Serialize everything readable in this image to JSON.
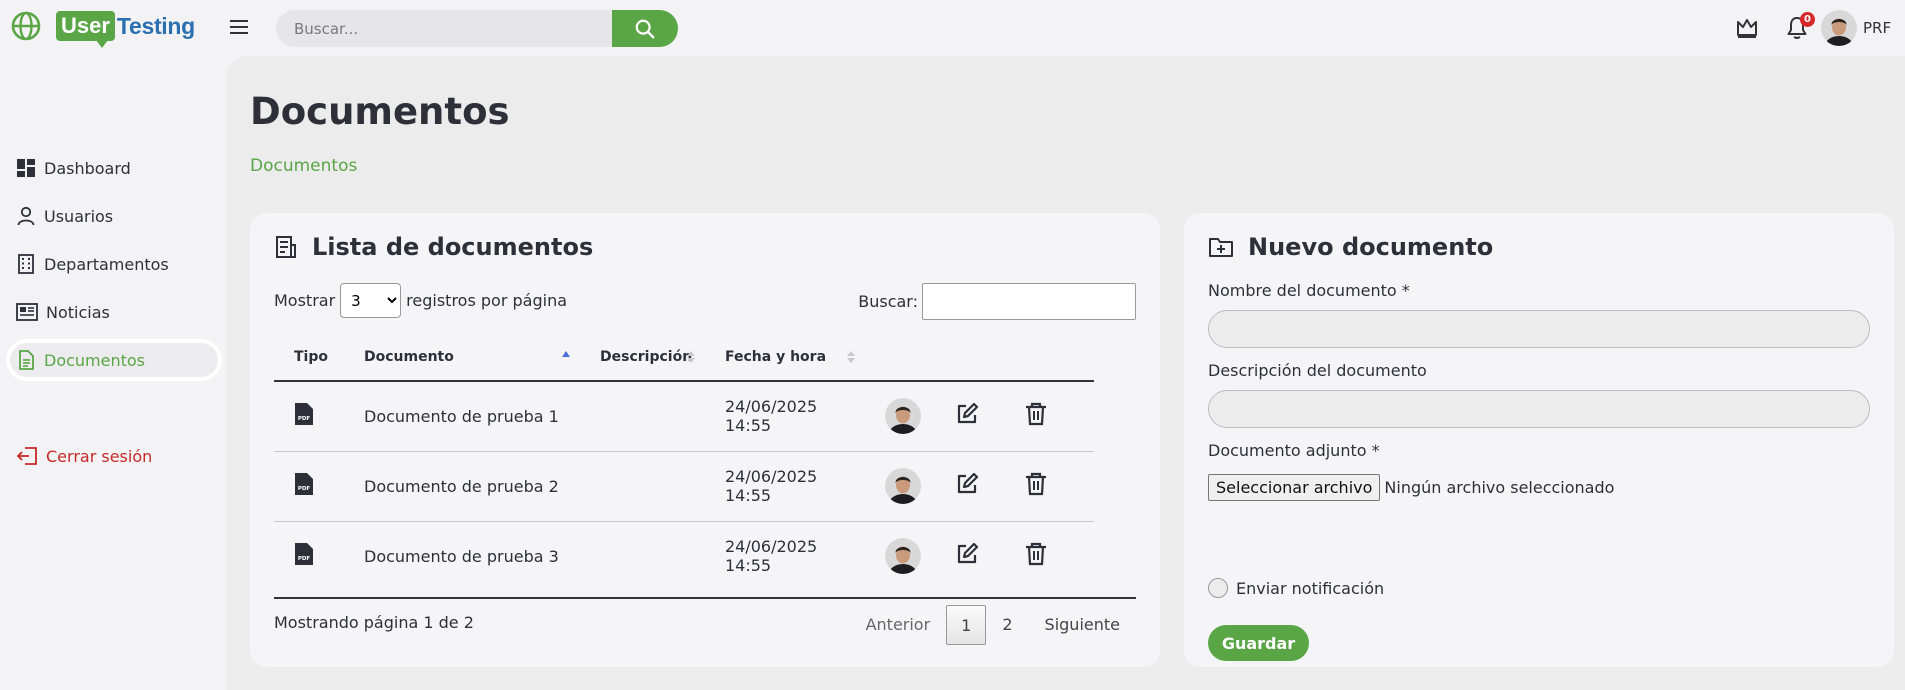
{
  "brand": {
    "part1": "User",
    "part2": "Testing"
  },
  "search": {
    "placeholder": "Buscar..."
  },
  "notifications": {
    "count": "0"
  },
  "user": {
    "initials": "PRF"
  },
  "sidebar": {
    "items": [
      {
        "label": "Dashboard",
        "icon": "dashboard-icon"
      },
      {
        "label": "Usuarios",
        "icon": "user-icon"
      },
      {
        "label": "Departamentos",
        "icon": "building-icon"
      },
      {
        "label": "Noticias",
        "icon": "newspaper-icon"
      },
      {
        "label": "Documentos",
        "icon": "document-icon",
        "active": true
      }
    ],
    "logout": "Cerrar sesión"
  },
  "page": {
    "title": "Documentos",
    "breadcrumb": "Documentos"
  },
  "list": {
    "title": "Lista de documentos",
    "length_prefix": "Mostrar",
    "length_value": "3",
    "length_suffix": "registros por página",
    "filter_label": "Buscar:",
    "columns": [
      "Tipo",
      "Documento",
      "Descripción",
      "Fecha y hora"
    ],
    "rows": [
      {
        "type": "pdf",
        "name": "Documento de prueba 1",
        "description": "",
        "date": "24/06/2025 14:55"
      },
      {
        "type": "pdf",
        "name": "Documento de prueba 2",
        "description": "",
        "date": "24/06/2025 14:55"
      },
      {
        "type": "pdf",
        "name": "Documento de prueba 3",
        "description": "",
        "date": "24/06/2025 14:55"
      }
    ],
    "info": "Mostrando página 1 de 2",
    "pager": {
      "prev": "Anterior",
      "pages": [
        "1",
        "2"
      ],
      "current": "1",
      "next": "Siguiente"
    }
  },
  "form": {
    "title": "Nuevo documento",
    "name_label": "Nombre del documento *",
    "name_value": "",
    "desc_label": "Descripción del documento",
    "desc_value": "",
    "file_label": "Documento adjunto *",
    "file_button": "Seleccionar archivo",
    "file_status": "Ningún archivo seleccionado",
    "notify_label": "Enviar notificación",
    "save_label": "Guardar"
  },
  "colors": {
    "accent": "#5aa646",
    "danger": "#c62828",
    "brand_blue": "#2a6fb0",
    "badge": "#d62828"
  }
}
